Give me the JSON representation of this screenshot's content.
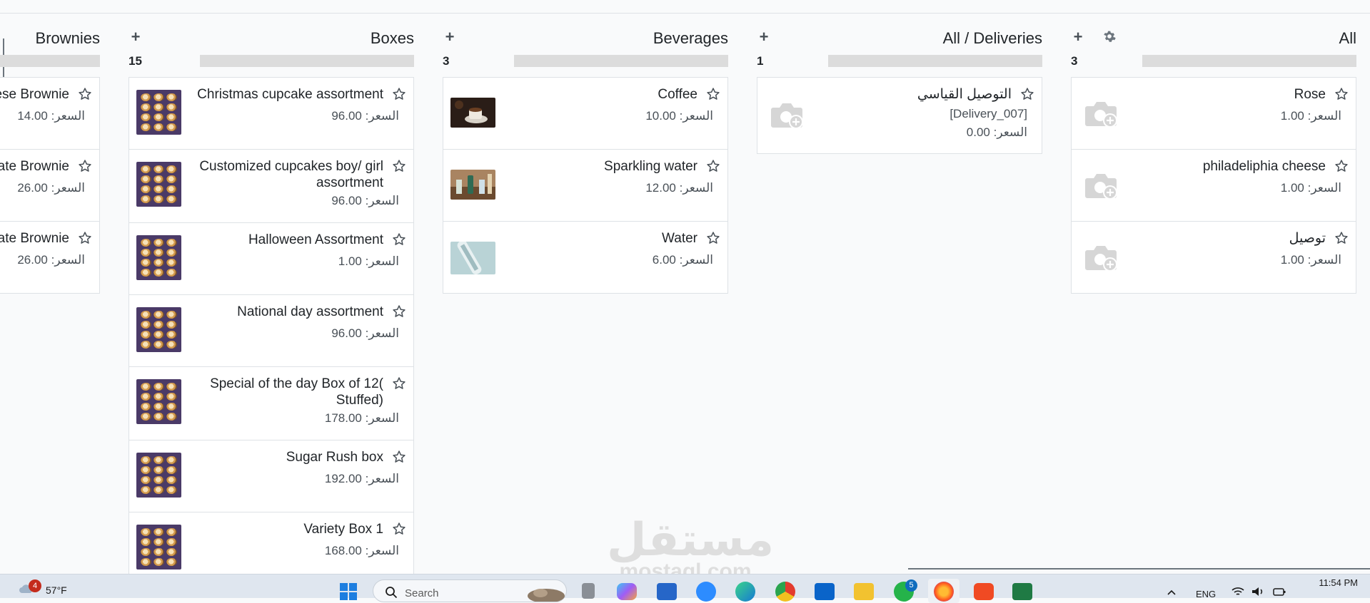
{
  "columns": [
    {
      "title": "Brownies",
      "count": "",
      "cards": [
        {
          "name": "ese Brownie",
          "price": "السعر: 14.00"
        },
        {
          "name": "ate Brownie",
          "price": "السعر: 26.00"
        },
        {
          "name": "ate Brownie",
          "price": "السعر: 26.00"
        }
      ]
    },
    {
      "title": "Boxes",
      "count": "15",
      "cards": [
        {
          "name": "Christmas cupcake assortment",
          "price": "السعر: 96.00"
        },
        {
          "name": "Customized cupcakes boy/ girl assortment",
          "price": "السعر: 96.00"
        },
        {
          "name": "Halloween Assortment",
          "price": "السعر: 1.00"
        },
        {
          "name": "National day assortment",
          "price": "السعر: 96.00"
        },
        {
          "name": "Special of the day Box of 12( Stuffed)",
          "price": "السعر: 178.00"
        },
        {
          "name": "Sugar Rush box",
          "price": "السعر: 192.00"
        },
        {
          "name": "Variety Box 1",
          "price": "السعر: 168.00"
        }
      ]
    },
    {
      "title": "Beverages",
      "count": "3",
      "cards": [
        {
          "name": "Coffee",
          "price": "السعر: 10.00"
        },
        {
          "name": "Sparkling water",
          "price": "السعر: 12.00"
        },
        {
          "name": "Water",
          "price": "السعر: 6.00"
        }
      ]
    },
    {
      "title": "All / Deliveries",
      "count": "1",
      "cards": [
        {
          "name": "التوصيل القياسي",
          "ref": "[Delivery_007]",
          "price": "السعر: 0.00"
        }
      ]
    },
    {
      "title": "All",
      "count": "3",
      "cards": [
        {
          "name": "Rose",
          "price": "السعر: 1.00"
        },
        {
          "name": "philadeliphia cheese",
          "price": "السعر: 1.00"
        },
        {
          "name": "توصيل",
          "price": "السعر: 1.00"
        }
      ]
    }
  ],
  "watermark": {
    "arabic": "مستقل",
    "latin": "mostaql.com"
  },
  "taskbar": {
    "weather_badge": "4",
    "weather_temp": "57°F",
    "search_placeholder": "Search",
    "whatsapp_badge": "5",
    "language": "ENG",
    "time": "11:54 PM"
  },
  "icons": {
    "add": "plus-icon",
    "settings": "gear-icon",
    "favorite": "star-outline-icon",
    "no_image": "camera-plus-icon"
  },
  "colors": {
    "background": "#f9fafb",
    "card": "#ffffff",
    "progress_track": "#dcdcdc",
    "taskbar": "#dfe6ef"
  }
}
